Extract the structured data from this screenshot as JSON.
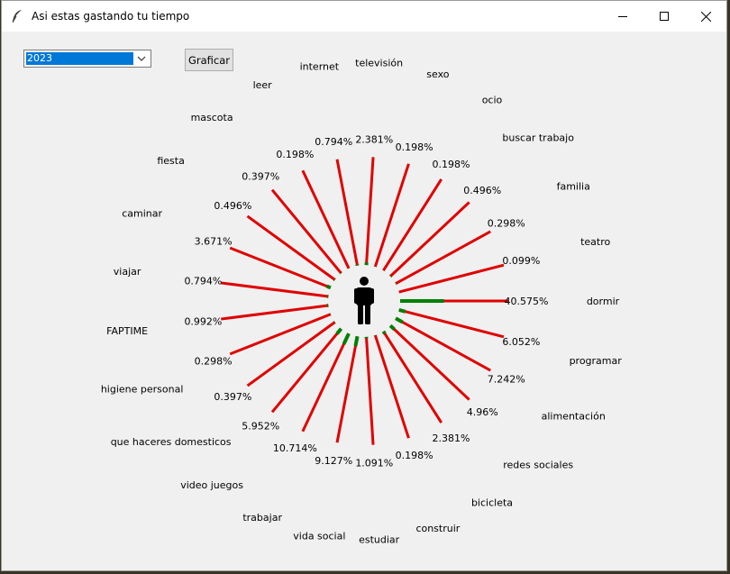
{
  "window": {
    "title": "Asi estas gastando tu tiempo"
  },
  "controls": {
    "year_selected": "2023",
    "graph_button_label": "Graficar"
  },
  "icons": {
    "app": "feather-icon",
    "center": "person-icon",
    "dropdown": "chevron-down-icon"
  },
  "colors": {
    "bar": "#e00000",
    "progress": "#008000",
    "person": "#000000"
  },
  "chart_data": {
    "type": "radial-bar",
    "unit": "%",
    "categories": [
      {
        "label": "dormir",
        "value": 40.575
      },
      {
        "label": "teatro",
        "value": 0.099
      },
      {
        "label": "familia",
        "value": 0.298
      },
      {
        "label": "buscar trabajo",
        "value": 0.496
      },
      {
        "label": "ocio",
        "value": 0.198
      },
      {
        "label": "sexo",
        "value": 0.198
      },
      {
        "label": "televisión",
        "value": 2.381
      },
      {
        "label": "internet",
        "value": 0.794
      },
      {
        "label": "leer",
        "value": 0.198
      },
      {
        "label": "mascota",
        "value": 0.397
      },
      {
        "label": "fiesta",
        "value": 0.496
      },
      {
        "label": "caminar",
        "value": 3.671
      },
      {
        "label": "viajar",
        "value": 0.794
      },
      {
        "label": "FAPTIME",
        "value": 0.992
      },
      {
        "label": "higiene personal",
        "value": 0.298
      },
      {
        "label": "que haceres domesticos",
        "value": 0.397
      },
      {
        "label": "video juegos",
        "value": 5.952
      },
      {
        "label": "trabajar",
        "value": 10.714
      },
      {
        "label": "vida social",
        "value": 9.127
      },
      {
        "label": "estudiar",
        "value": 1.091
      },
      {
        "label": "construir",
        "value": 0.198
      },
      {
        "label": "bicicleta",
        "value": 2.381
      },
      {
        "label": "redes sociales",
        "value": 4.96
      },
      {
        "label": "alimentación",
        "value": 7.242
      },
      {
        "label": "programar",
        "value": 6.052
      }
    ]
  }
}
